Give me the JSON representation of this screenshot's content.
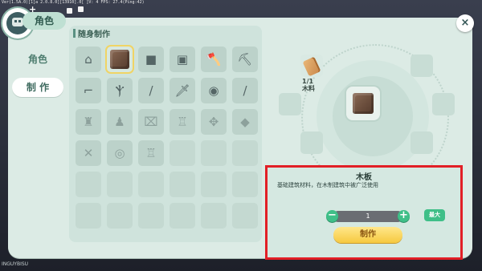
{
  "debug": "Ver(1.5A.0)[1]a 2.0.8.0][13910].0[ ]V: 4 FPS: 27.4(Ping:42)",
  "hud": {
    "star": "+"
  },
  "window": {
    "title": "角色",
    "close": "×"
  },
  "nav": {
    "role": "角色",
    "craft": "制 作"
  },
  "section": {
    "title": "随身制作"
  },
  "grid": {
    "slots": [
      {
        "icon": "workbench-icon",
        "glyph": "⌂"
      },
      {
        "icon": "wood-plank-icon",
        "glyph": ""
      },
      {
        "icon": "stone-block-icon",
        "glyph": "■"
      },
      {
        "icon": "wooden-crate-icon",
        "glyph": "▣"
      },
      {
        "icon": "axe-icon",
        "glyph": "🪓"
      },
      {
        "icon": "pickaxe-icon",
        "glyph": "⛏"
      },
      {
        "icon": "shovel-icon",
        "glyph": "⌐"
      },
      {
        "icon": "hoe-rake-icon",
        "glyph": "Ⲯ"
      },
      {
        "icon": "torch-icon",
        "glyph": "/"
      },
      {
        "icon": "sword-icon",
        "glyph": "🗡"
      },
      {
        "icon": "shield-icon",
        "glyph": "◉"
      },
      {
        "icon": "spear-icon",
        "glyph": "/"
      },
      {
        "icon": "bell-icon",
        "glyph": "♜"
      },
      {
        "icon": "statue-icon",
        "glyph": "♟"
      },
      {
        "icon": "lantern-icon",
        "glyph": "⌧"
      },
      {
        "icon": "fire-hydrant-icon",
        "glyph": "♖"
      },
      {
        "icon": "knot-frame-icon",
        "glyph": "✥"
      },
      {
        "icon": "stone-slab-icon",
        "glyph": "◆"
      },
      {
        "icon": "bone-icon",
        "glyph": "✕"
      },
      {
        "icon": "disc-icon",
        "glyph": "◎"
      },
      {
        "icon": "stone-jar-icon",
        "glyph": "♖"
      }
    ]
  },
  "recipe": {
    "ingredient_label": "1/1\n木料"
  },
  "detail": {
    "name": "木板",
    "description": "基础建筑材料，在木制建筑中被广泛使用",
    "quantity": "1",
    "minus": "−",
    "plus": "+",
    "max_label": "最大",
    "craft_label": "制作"
  },
  "brand": "INGUYBISU"
}
